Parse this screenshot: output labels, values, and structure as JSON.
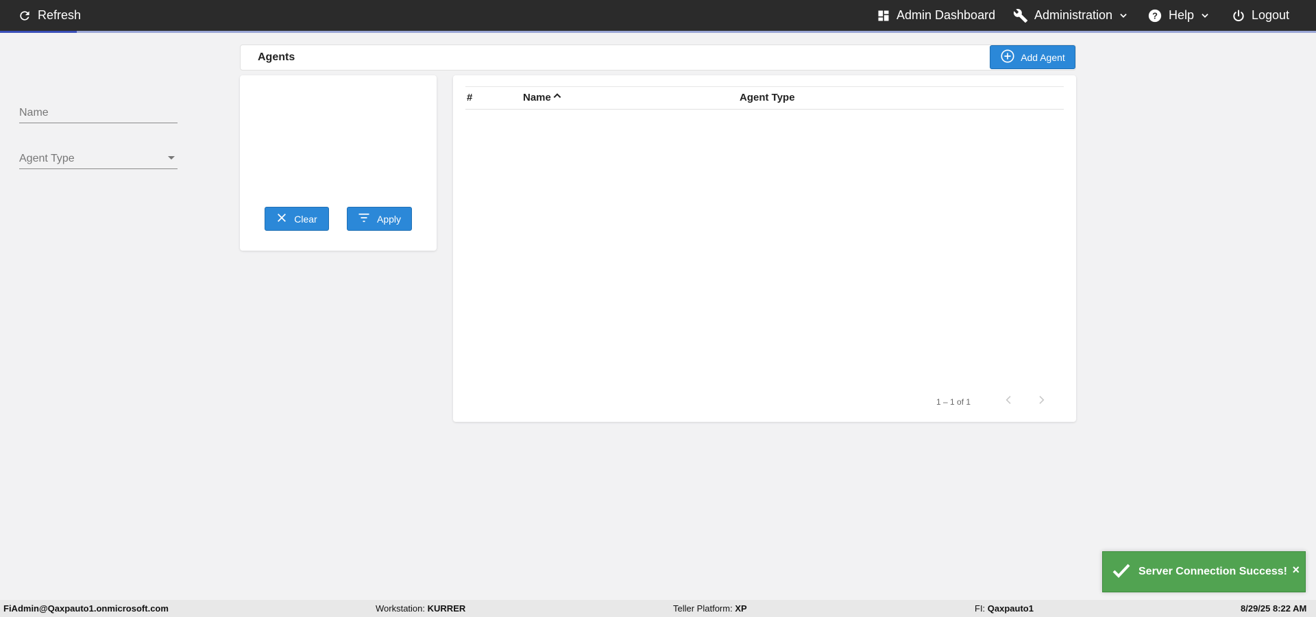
{
  "topbar": {
    "refresh_label": "Refresh",
    "dashboard_label": "Admin Dashboard",
    "administration_label": "Administration",
    "help_label": "Help",
    "logout_label": "Logout"
  },
  "header": {
    "title": "Agents",
    "add_button_label": "Add Agent"
  },
  "filters": {
    "name_placeholder": "Name",
    "agent_type_label": "Agent Type",
    "clear_label": "Clear",
    "apply_label": "Apply"
  },
  "table": {
    "columns": [
      "#",
      "Name",
      "Agent Type"
    ],
    "sort_column": "Name",
    "sort_direction": "ascending",
    "rows": [],
    "pagination": "1 – 1 of 1"
  },
  "toast": {
    "message": "Server Connection Success!",
    "close_label": "×"
  },
  "statusbar": {
    "user": "FiAdmin@Qaxpauto1.onmicrosoft.com",
    "workstation_label": "Workstation:",
    "workstation_value": "KURRER",
    "teller_platform_label": "Teller Platform:",
    "teller_platform_value": "XP",
    "fi_label": "FI:",
    "fi_value": "Qaxpauto1",
    "datetime": "8/29/25 8:22 AM"
  },
  "colors": {
    "topbar_bg": "#2b2b2b",
    "primary_button": "#2b88d8",
    "toast_success": "#51a351",
    "page_bg": "#f2f2f3"
  }
}
